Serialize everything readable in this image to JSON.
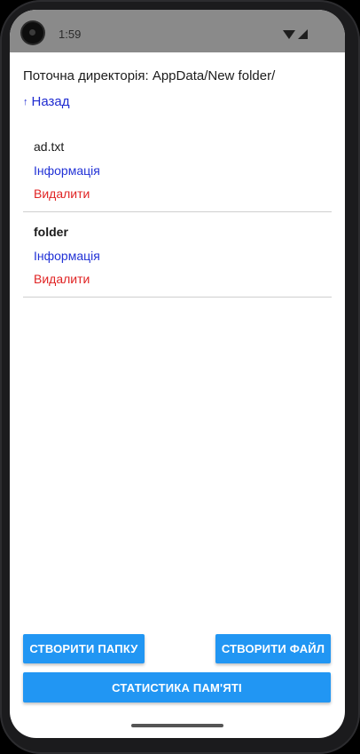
{
  "status_bar": {
    "time": "1:59",
    "icons": [
      "camera-icon",
      "wifi-icon",
      "signal-icon"
    ]
  },
  "directory": {
    "current_label": "Поточна директорія: AppData/New folder/",
    "back_arrow": "↑",
    "back_label": "Назад"
  },
  "files": [
    {
      "name": "ad.txt",
      "bold": false,
      "info_label": "Інформація",
      "delete_label": "Видалити"
    },
    {
      "name": "folder",
      "bold": true,
      "info_label": "Інформація",
      "delete_label": "Видалити"
    }
  ],
  "buttons": {
    "create_folder": "СТВОРИТИ ПАПКУ",
    "create_file": "СТВОРИТИ ФАЙЛ",
    "memory_stats": "СТАТИСТИКА ПАМ'ЯТІ"
  },
  "colors": {
    "accent": "#2196f3",
    "link": "#1f2bd1",
    "danger": "#e02424",
    "status_bar": "#8a8a8a"
  }
}
